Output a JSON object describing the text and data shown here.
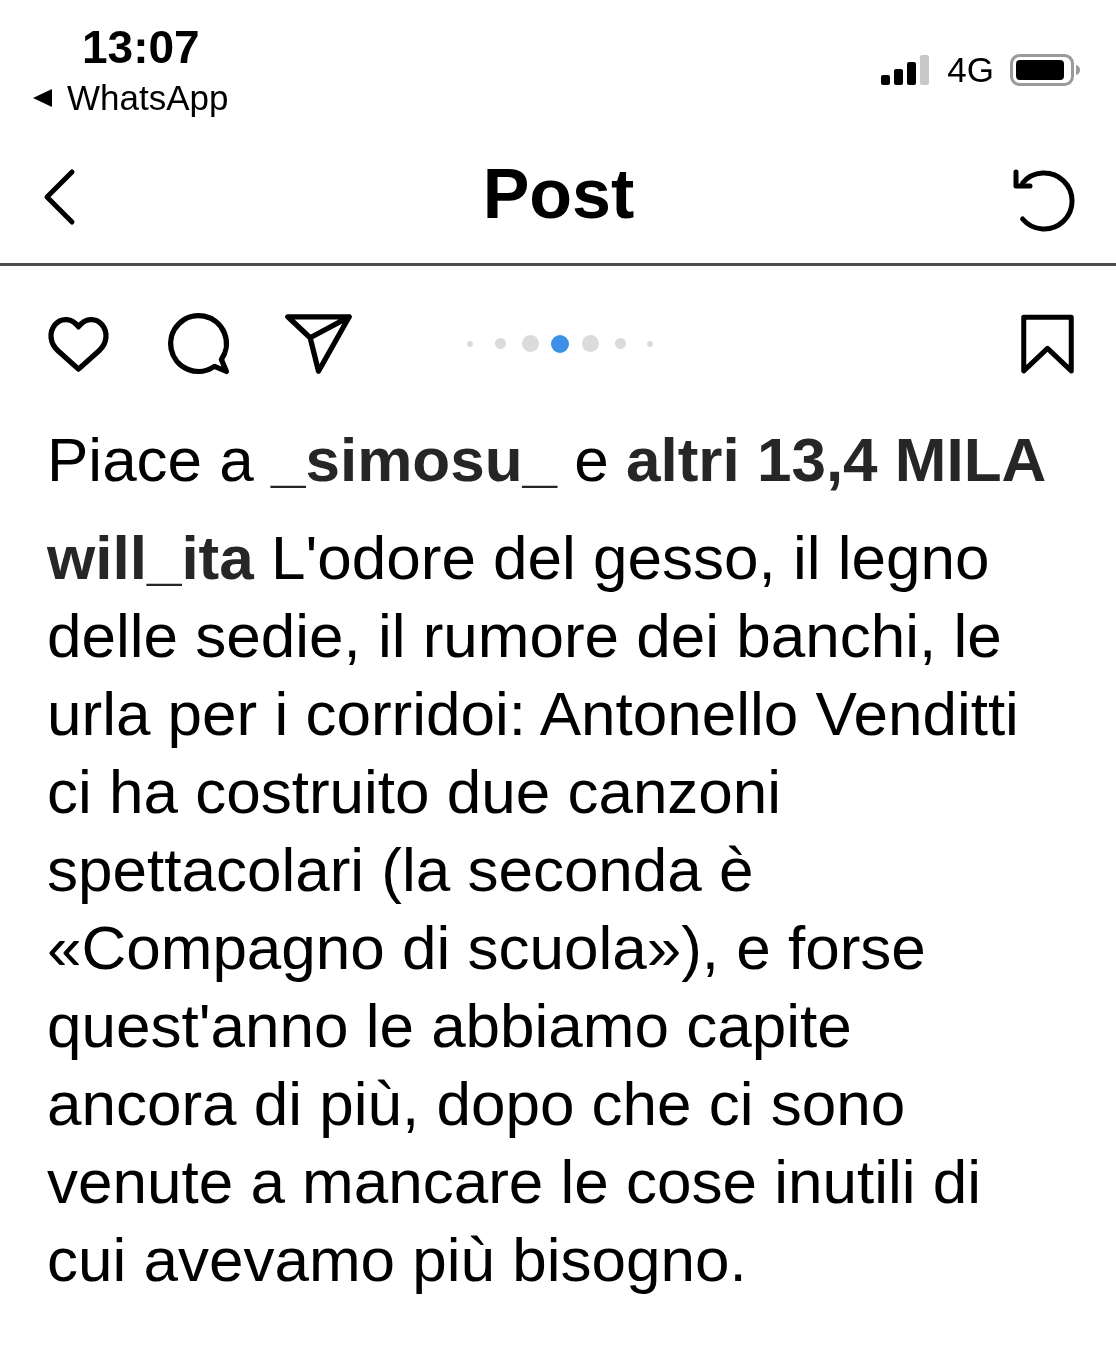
{
  "status_bar": {
    "time": "13:07",
    "back_app": "WhatsApp",
    "network": "4G"
  },
  "header": {
    "title": "Post"
  },
  "carousel": {
    "dots": [
      {
        "selected": false
      },
      {
        "selected": false
      },
      {
        "selected": false
      },
      {
        "selected": true
      },
      {
        "selected": false
      },
      {
        "selected": false
      },
      {
        "selected": false
      }
    ]
  },
  "likes": {
    "text": "Piace a **_simosu_** e **altri 13,4 MILA**"
  },
  "caption": {
    "text": "**will_ita** L'odore del gesso, il legno delle sedie, il rumore dei banchi, le urla per i corridoi: Antonello Venditti ci ha costruito due canzoni spettacolari (la seconda è «Compagno di scuola»), e forse quest'anno le abbiamo capite ancora di più, dopo che ci sono venute a mancare le cose inutili di cui avevamo più bisogno."
  }
}
